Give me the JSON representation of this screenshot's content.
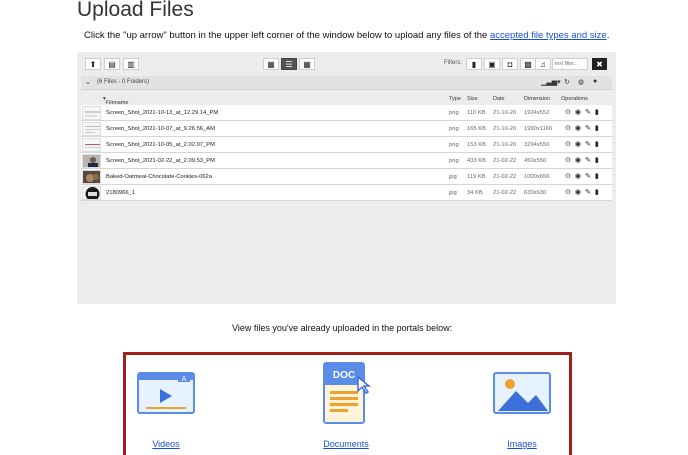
{
  "page": {
    "title": "Upload Files",
    "instructions_prefix": "Click the \"up arrow\" button in the upper left corner of the window below to upload any files of the ",
    "instructions_link": "accepted file types and size",
    "instructions_suffix": "."
  },
  "toolbar": {
    "filters_label": "Filters:",
    "filter_placeholder": "text filter...",
    "clear_label": "✖"
  },
  "crumb": {
    "label": "(6 Files - 0 Folders)"
  },
  "columns": {
    "filename": "Filename",
    "type": "Type",
    "size": "Size",
    "date": "Date",
    "dimension": "Dimension",
    "operations": "Operations"
  },
  "files": [
    {
      "name": "Screen_Shot_2021-10-13_at_12.29.14_PM",
      "type": "png",
      "size": "110 KB",
      "date": "21-10-20",
      "dimension": "1924x552"
    },
    {
      "name": "Screen_Shot_2021-10-07_at_9.26.56_AM",
      "type": "png",
      "size": "165 KB",
      "date": "21-10-20",
      "dimension": "1990x1166"
    },
    {
      "name": "Screen_Shot_2021-10-05_at_2.02.07_PM",
      "type": "png",
      "size": "153 KB",
      "date": "21-10-20",
      "dimension": "3294x550"
    },
    {
      "name": "Screen_Shot_2021-02-22_at_2.09.53_PM",
      "type": "png",
      "size": "433 KB",
      "date": "21-02-22",
      "dimension": "450x550"
    },
    {
      "name": "Baked-Oatmeal-Chocolate-Cookies-062a",
      "type": "jpg",
      "size": "119 KB",
      "date": "21-02-22",
      "dimension": "1000x656"
    },
    {
      "name": "2180966_1",
      "type": "jpg",
      "size": "34 KB",
      "date": "21-02-22",
      "dimension": "630x630"
    }
  ],
  "portals": {
    "caption": "View files you've already uploaded in the portals below:",
    "videos": "Videos",
    "documents": "Documents",
    "images": "Images",
    "doc_badge": "DOC",
    "video_badge": "A"
  },
  "colors": {
    "link": "#1a4fd6",
    "portal_border": "#a01f1f",
    "panel_bg": "#ececec"
  }
}
